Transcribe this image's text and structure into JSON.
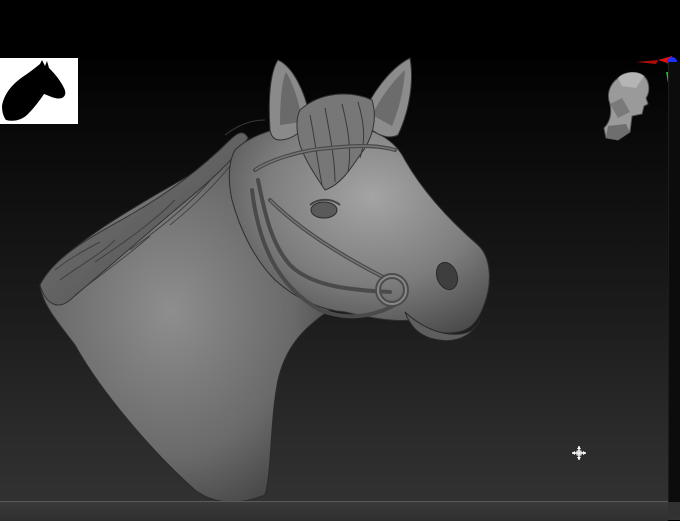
{
  "viewport": {
    "background_top": "#000000",
    "background_bottom": "#333333"
  },
  "model": {
    "name_icon": "horse-head-bust",
    "material_color": "#8a8a8a"
  },
  "thumbnail": {
    "icon": "horse-silhouette-icon",
    "background": "#ffffff"
  },
  "navigation": {
    "icon": "head-navigation-icon",
    "axis_colors": {
      "x": "#e01010",
      "y": "#20c020",
      "z": "#2030ff"
    }
  },
  "cursor": {
    "icon": "move-cursor-icon"
  }
}
